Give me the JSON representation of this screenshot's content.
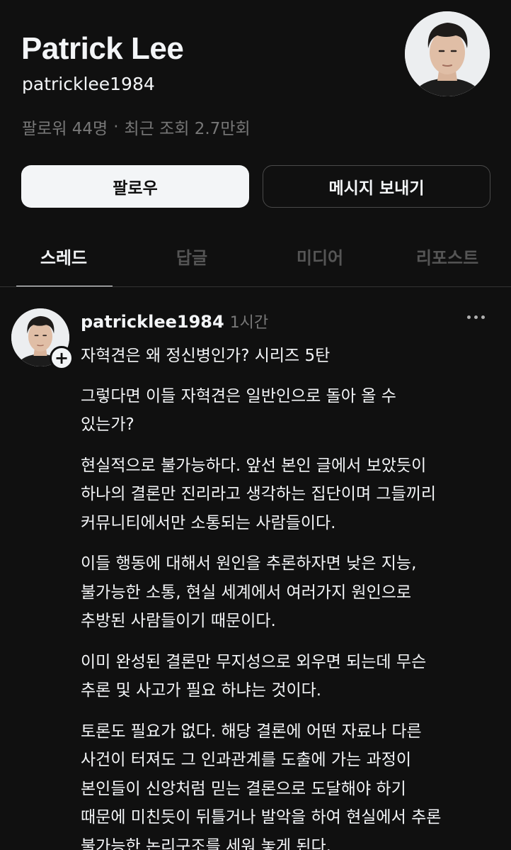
{
  "profile": {
    "name": "Patrick Lee",
    "handle": "patricklee1984",
    "followers": "팔로워 44명",
    "separator": "·",
    "recent_views": "최근 조회 2.7만회"
  },
  "buttons": {
    "follow": "팔로우",
    "message": "메시지 보내기"
  },
  "tabs": [
    {
      "label": "스레드",
      "active": true
    },
    {
      "label": "답글",
      "active": false
    },
    {
      "label": "미디어",
      "active": false
    },
    {
      "label": "리포스트",
      "active": false
    }
  ],
  "post": {
    "author": "patricklee1984",
    "time": "1시간",
    "plus": "+",
    "paragraphs": [
      "자혁견은 왜 정신병인가? 시리즈 5탄",
      "그렇다면 이들 자혁견은 일반인으로 돌아 올 수\n있는가?",
      "현실적으로 불가능하다. 앞선 본인 글에서 보았듯이\n하나의 결론만 진리라고 생각하는 집단이며 그들끼리\n커뮤니티에서만 소통되는 사람들이다.",
      "이들 행동에 대해서 원인을 추론하자면 낮은 지능,\n불가능한 소통, 현실 세계에서 여러가지 원인으로\n추방된 사람들이기 때문이다.",
      "이미 완성된 결론만 무지성으로 외우면 되는데 무슨\n추론 및 사고가 필요 하냐는 것이다.",
      "토론도 필요가 없다. 해당 결론에 어떤 자료나 다른\n사건이 터져도 그 인과관계를 도출에 가는 과정이\n본인들이 신앙처럼 믿는 결론으로 도달해야 하기\n때문에 미친듯이 뒤틀거나 발악을 하여 현실에서 추론\n불가능한 논리구조를 세워 놓게 된다."
    ]
  },
  "colors": {
    "background": "#101010",
    "text": "#f3f5f7",
    "muted": "#777777",
    "inactive_tab": "#555555"
  }
}
